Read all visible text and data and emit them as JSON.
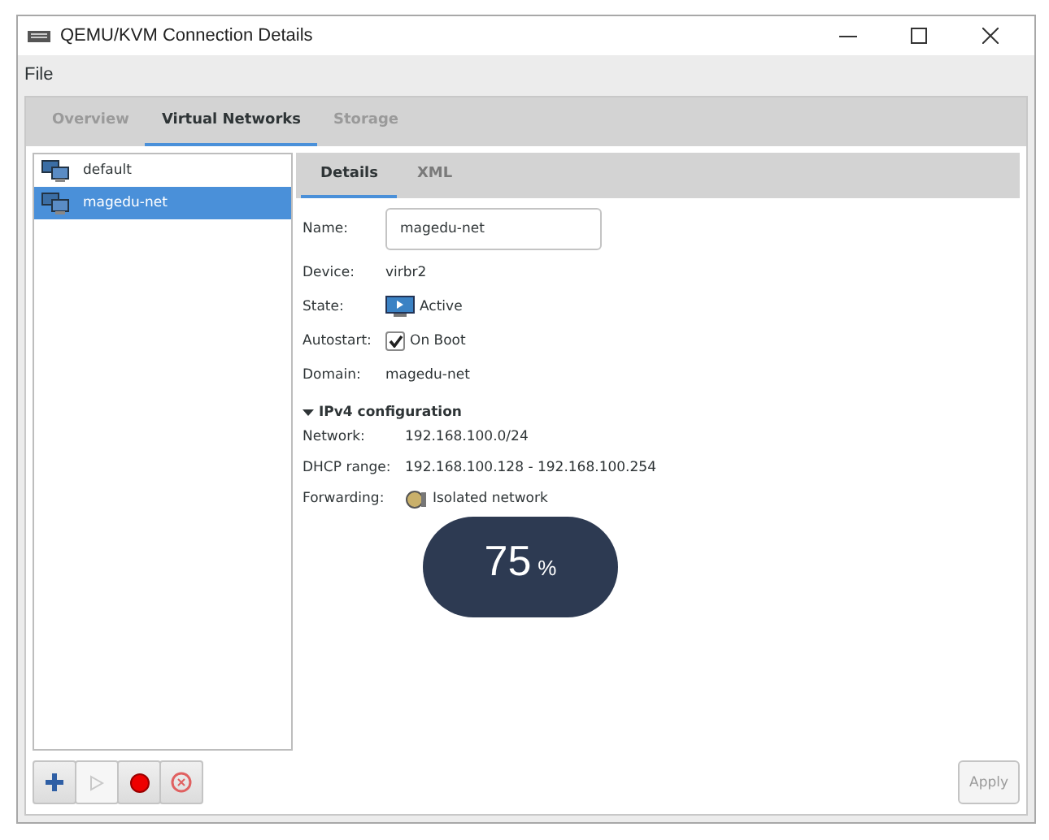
{
  "window": {
    "title": "QEMU/KVM Connection Details"
  },
  "menu": [
    "File"
  ],
  "tabs": [
    {
      "label": "Overview",
      "selected": false
    },
    {
      "label": "Virtual Networks",
      "selected": true
    },
    {
      "label": "Storage",
      "selected": false
    }
  ],
  "networks": [
    {
      "name": "default",
      "selected": false
    },
    {
      "name": "magedu-net",
      "selected": true
    }
  ],
  "detail_tabs": [
    {
      "label": "Details",
      "selected": true
    },
    {
      "label": "XML",
      "selected": false
    }
  ],
  "details": {
    "name": {
      "label": "Name:",
      "value": "magedu-net"
    },
    "device": {
      "label": "Device:",
      "value": "virbr2"
    },
    "state": {
      "label": "State:",
      "value": "Active"
    },
    "autostart": {
      "label": "Autostart:",
      "value": "On Boot",
      "checked": true
    },
    "domain": {
      "label": "Domain:",
      "value": "magedu-net"
    },
    "ipv4": {
      "title": "IPv4 configuration",
      "expanded": true,
      "rows": [
        {
          "label": "Network:",
          "value": "192.168.100.0/24"
        },
        {
          "label": "DHCP range:",
          "value": "192.168.100.128 - 192.168.100.254"
        },
        {
          "label": "Forwarding:",
          "value": "Isolated network",
          "kind": "forwarding"
        }
      ]
    }
  },
  "toolbar": [
    {
      "kind": "add",
      "disabled": false
    },
    {
      "kind": "start",
      "disabled": true
    },
    {
      "kind": "stop",
      "disabled": false
    },
    {
      "kind": "delete",
      "disabled": false
    }
  ],
  "apply": {
    "label": "Apply",
    "disabled": true
  },
  "zoom_overlay": {
    "value": "75",
    "unit": "%"
  }
}
